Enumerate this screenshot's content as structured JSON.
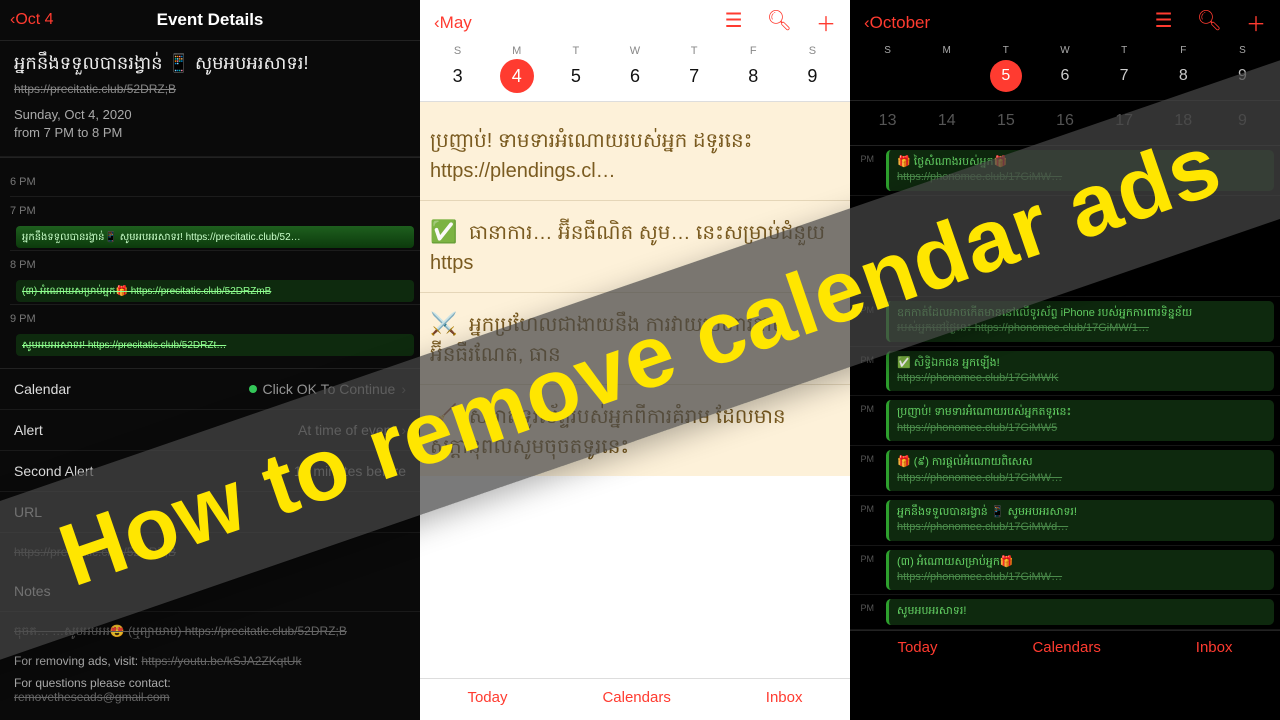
{
  "banner_text": "How to remove calendar ads",
  "left": {
    "back_label": "Oct 4",
    "title": "Event Details",
    "event_title": "អ្នកនឹងទទួលបានរង្វាន់ 📱 សូមអបអរសាទរ!",
    "event_url": "https://precitatic.club/52DRZ;B",
    "date_line1": "Sunday, Oct 4, 2020",
    "date_line2": "from 7 PM to 8 PM",
    "timeline": [
      {
        "label": "6 PM"
      },
      {
        "label": "7 PM",
        "text": "អ្នកនឹងទទួលបានរង្វាន់📱 សូមអបអរសាទរ! https://precitatic.club/52…"
      },
      {
        "label": "8 PM",
        "text": "(៣) អំណោយសម្រាប់អ្នក🎁 https://precitatic.club/52DRZmB"
      },
      {
        "label": "9 PM",
        "text": "សូមអបអរសាទរ! https://precitatic.club/52DRZt…"
      }
    ],
    "rows": {
      "calendar_k": "Calendar",
      "calendar_v": "Click OK To Continue",
      "alert_k": "Alert",
      "alert_v": "At time of event",
      "alert2_k": "Second Alert",
      "alert2_v": "19 minutes before",
      "url_k": "URL",
      "url_v": "https://precitatic.club/52DRZ;B",
      "notes_k": "Notes",
      "notes_body": "ចុចត… …សូមអបអរ😍 (ឬព្យាយាម) https://precitatic.club/52DRZ;B"
    },
    "footer": {
      "l1": "For removing ads, visit:",
      "l1s": "https://youtu.be/kSJA2ZKqtUk",
      "l2": "For questions please contact:",
      "l2s": "removetheseads@gmail.com"
    }
  },
  "mid": {
    "back_label": "May",
    "week": [
      "S",
      "M",
      "T",
      "W",
      "T",
      "F",
      "S"
    ],
    "days": [
      "3",
      "4",
      "5",
      "6",
      "7",
      "8",
      "9"
    ],
    "selected_index": 1,
    "items": [
      {
        "emoji": "",
        "text": "ប្រញាប់! ទាមទារអំណោយរបស់អ្នក ដទូរ​នេះ https://plendings.cl…"
      },
      {
        "emoji": "✅",
        "text": "ធានាការ… អ៊ីនធឺណិត សូម… នេះសម្រាប់ជំនួយ https"
      },
      {
        "emoji": "⚔️",
        "text": "អ្នកប្រហែលជាងាយនឹង ការវាយប្រហារតាមអ៊ីនធឺរណែត, ធាន"
      },
      {
        "emoji": "🧹",
        "text": "សម្អាតទូរស័ព្ទរបស់អ្នកពីការគំរាម ដែលមានសក្តានុពលសូមចុចតទូរនេះ"
      }
    ],
    "tabs": [
      "Today",
      "Calendars",
      "Inbox"
    ]
  },
  "right": {
    "back_label": "October",
    "week": [
      "S",
      "M",
      "T",
      "W",
      "T",
      "F",
      "S"
    ],
    "row1": [
      "",
      "",
      "5",
      "6",
      "7",
      "8",
      "9"
    ],
    "row2": [
      "13",
      "14",
      "15",
      "16",
      "17",
      "18",
      "9"
    ],
    "selected_index": 2,
    "events": [
      {
        "t": "PM",
        "line1": "🎁 ថ្ងៃសំណាងរបស់អ្នក🎁",
        "line2": "https://phonomee.club/17GiMW…"
      },
      {
        "t": "",
        "gap": true
      },
      {
        "t": "PM",
        "line1": "ឧកកាត់ដែលអាចកើតមាននៅលើទូរស័ព្ទ iPhone របស់អ្នកការពារទិន្នន័យ",
        "line2": "របស់អ្នកនៅថ្ងៃនេះ https://phonomee.club/17GiMW/1…"
      },
      {
        "t": "PM",
        "line1": "✅ សិទ្ធិឯកជន អ្នកឡើង!",
        "line2": "https://phonomee.club/17GiMWK"
      },
      {
        "t": "PM",
        "line1": "ប្រញាប់! ទាមទារអំណោយរបស់អ្នកតទូរនេះ",
        "line2": "https://phonomee.club/17GiMW5"
      },
      {
        "t": "PM",
        "line1": "🎁 (៩) ការផ្ដល់អំណោយពិសេស",
        "line2": "https://phonomee.club/17GiMW…"
      },
      {
        "t": "PM",
        "line1": "អ្នកនឹងទទួលបានរង្វាន់ 📱 សូមអបអរសាទរ!",
        "line2": "https://phonomee.club/17GiMWd…"
      },
      {
        "t": "PM",
        "line1": "(៣) អំណោយសម្រាប់អ្នក🎁",
        "line2": "https://phonomee.club/17GiMW…"
      },
      {
        "t": "PM",
        "line1": "សូមអបអរសាទរ!",
        "line2": ""
      }
    ],
    "tabs": [
      "Today",
      "Calendars",
      "Inbox"
    ]
  }
}
